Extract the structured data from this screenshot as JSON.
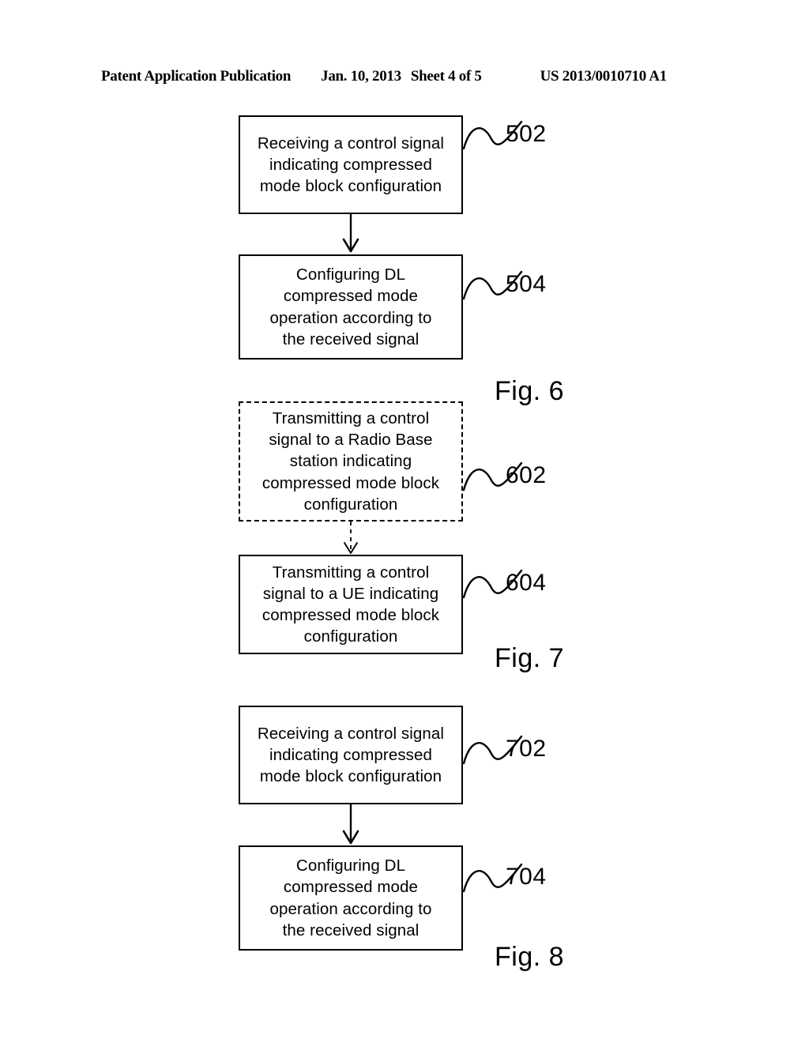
{
  "page": {
    "background": "#ffffff",
    "ink": "#000000"
  },
  "header": {
    "publication": "Patent Application Publication",
    "date": "Jan. 10, 2013",
    "sheet": "Sheet 4 of 5",
    "patent_number": "US 2013/0010710 A1"
  },
  "figures": [
    {
      "caption": "Fig. 6",
      "steps": [
        {
          "ref": "502",
          "border": "solid",
          "text": "Receiving a control signal indicating compressed mode block configuration",
          "lines": [
            "Receiving a control signal",
            "indicating compressed",
            "mode block configuration"
          ]
        },
        {
          "ref": "504",
          "border": "solid",
          "text": "Configuring DL compressed mode operation according to the received signal",
          "lines": [
            "Configuring DL",
            "compressed mode",
            "operation according to",
            "the received signal"
          ]
        }
      ],
      "connector": "solid-arrow"
    },
    {
      "caption": "Fig. 7",
      "steps": [
        {
          "ref": "602",
          "border": "dashed",
          "text": "Transmitting a control signal to a Radio Base station indicating compressed mode block configuration",
          "lines": [
            "Transmitting a control",
            "signal to a Radio Base",
            "station indicating",
            "compressed mode block",
            "configuration"
          ]
        },
        {
          "ref": "604",
          "border": "solid",
          "text": "Transmitting a control signal to a UE indicating compressed mode block configuration",
          "lines": [
            "Transmitting a control",
            "signal to a UE indicating",
            "compressed mode block",
            "configuration"
          ]
        }
      ],
      "connector": "dashed-arrow"
    },
    {
      "caption": "Fig. 8",
      "steps": [
        {
          "ref": "702",
          "border": "solid",
          "text": "Receiving a control signal indicating compressed mode block configuration",
          "lines": [
            "Receiving a control signal",
            "indicating compressed",
            "mode block configuration"
          ]
        },
        {
          "ref": "704",
          "border": "solid",
          "text": "Configuring DL compressed mode operation according to the received signal",
          "lines": [
            "Configuring DL",
            "compressed mode",
            "operation according to",
            "the received signal"
          ]
        }
      ],
      "connector": "solid-arrow"
    }
  ]
}
